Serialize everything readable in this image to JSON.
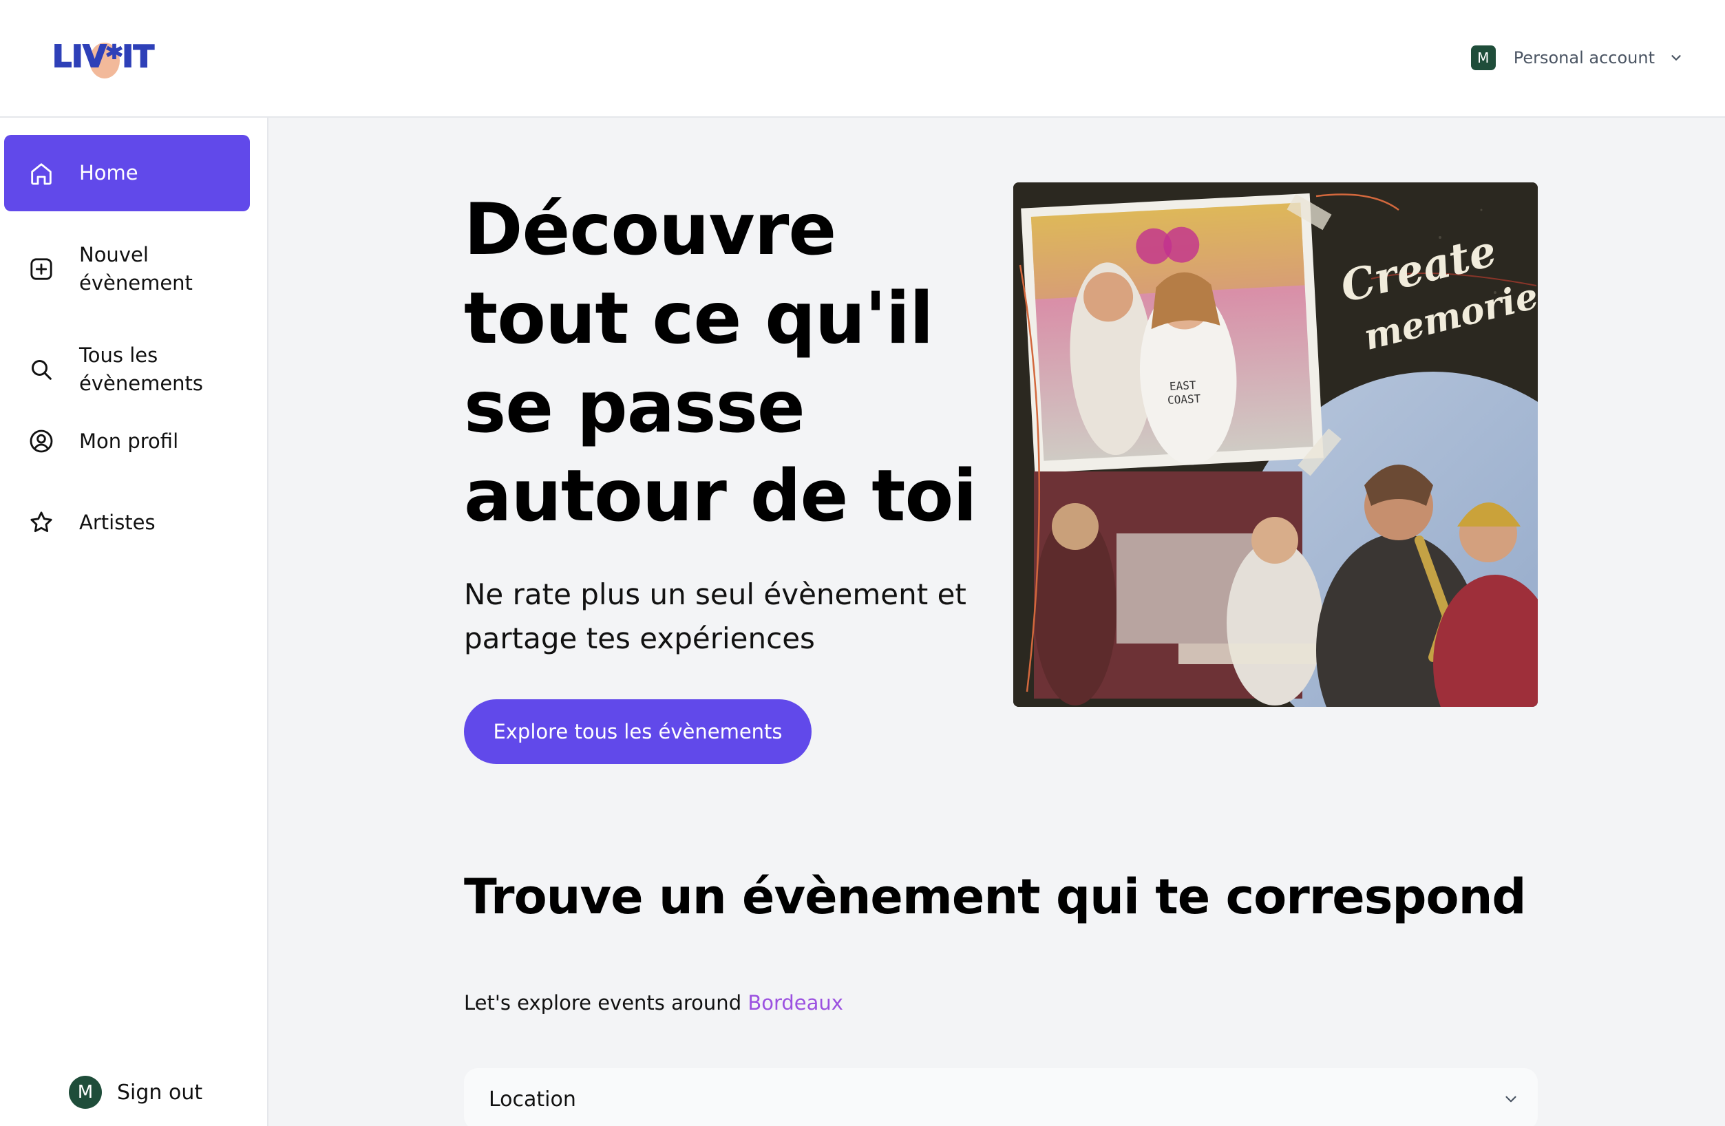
{
  "brand": {
    "logo_text": "LIV*IT",
    "colors": {
      "primary": "#6149ea",
      "logo_blue": "#2e40b8",
      "logo_peach": "#f2b99a",
      "avatar_green": "#1f4d3a",
      "city_link": "#9b51e0"
    }
  },
  "header": {
    "account_initial": "M",
    "account_label": "Personal account",
    "account_icon": "chevron-down-icon"
  },
  "sidebar": {
    "items": [
      {
        "label": "Home",
        "icon": "home-icon",
        "active": true
      },
      {
        "label": "Nouvel\névènement",
        "icon": "plus-square-icon",
        "active": false
      },
      {
        "label": "Tous les\névènements",
        "icon": "search-icon",
        "active": false
      },
      {
        "label": "Mon profil",
        "icon": "user-circle-icon",
        "active": false
      },
      {
        "label": "Artistes",
        "icon": "star-icon",
        "active": false
      }
    ],
    "signout": {
      "initial": "M",
      "label": "Sign out"
    }
  },
  "hero": {
    "title": "Découvre tout ce qu'il se passe autour de toi",
    "subtitle": "Ne rate plus un seul évènement et partage tes expériences",
    "cta_label": "Explore tous les évènements",
    "image_caption_line1": "Create",
    "image_caption_line2": "memories",
    "shirt_text_line1": "EAST",
    "shirt_text_line2": "COAST"
  },
  "find": {
    "title": "Trouve un évènement qui te correspond",
    "explore_prefix": "Let's explore events around ",
    "city": "Bordeaux",
    "location_label": "Location",
    "location_icon": "chevron-down-icon"
  }
}
